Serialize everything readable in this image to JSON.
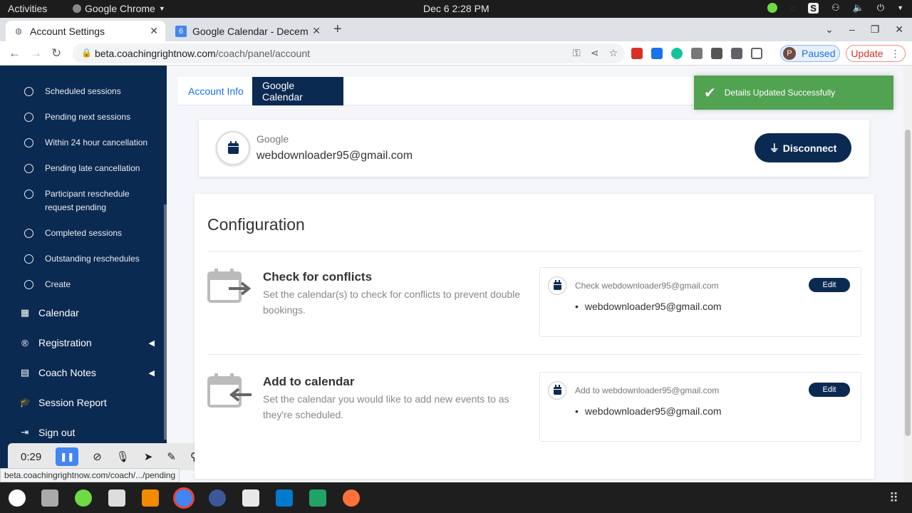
{
  "system": {
    "activities": "Activities",
    "app_name": "Google Chrome",
    "clock": "Dec 6  2:28 PM"
  },
  "browser": {
    "tabs": [
      {
        "label": "Account Settings",
        "active": true
      },
      {
        "label": "Google Calendar - Decem",
        "active": false
      }
    ],
    "url_host": "beta.coachingrightnow.com",
    "url_path": "/coach/panel/account",
    "profile_initial": "P",
    "profile_status": "Paused",
    "update_label": "Update",
    "recording_badge": "0:29",
    "status_url": "beta.coachingrightnow.com/coach/.../pending"
  },
  "sidebar": {
    "sub_items": [
      "Scheduled sessions",
      "Pending next sessions",
      "Within 24 hour cancellation",
      "Pending late cancellation",
      "Participant reschedule request pending",
      "Completed sessions",
      "Outstanding reschedules",
      "Create"
    ],
    "main_items": [
      {
        "label": "Calendar",
        "icon": "calendar-icon",
        "has_submenu": false
      },
      {
        "label": "Registration",
        "icon": "registration-icon",
        "has_submenu": true
      },
      {
        "label": "Coach Notes",
        "icon": "notes-icon",
        "has_submenu": true
      },
      {
        "label": "Session Report",
        "icon": "graduation-cap-icon",
        "has_submenu": false
      },
      {
        "label": "Sign out",
        "icon": "sign-out-icon",
        "has_submenu": false
      }
    ]
  },
  "recorder": {
    "time": "0:29"
  },
  "page": {
    "tabs": [
      {
        "label": "Account Info",
        "active": false
      },
      {
        "label": "Google Calendar",
        "active": true
      }
    ],
    "account": {
      "provider": "Google",
      "email": "webdownloader95@gmail.com",
      "disconnect_label": "Disconnect"
    },
    "configuration": {
      "title": "Configuration",
      "sections": [
        {
          "title": "Check for conflicts",
          "description": "Set the calendar(s) to check for conflicts to prevent double bookings.",
          "box_label": "Check webdownloader95@gmail.com",
          "calendars": [
            "webdownloader95@gmail.com"
          ],
          "edit_label": "Edit"
        },
        {
          "title": "Add to calendar",
          "description": "Set the calendar you would like to add new events to as they're scheduled.",
          "box_label": "Add to webdownloader95@gmail.com",
          "calendars": [
            "webdownloader95@gmail.com"
          ],
          "edit_label": "Edit"
        }
      ]
    },
    "toast": "Details Updated Successfully"
  },
  "colors": {
    "brand_navy": "#0b2a52",
    "toast_green": "#51a351",
    "link_blue": "#1a73e8"
  }
}
